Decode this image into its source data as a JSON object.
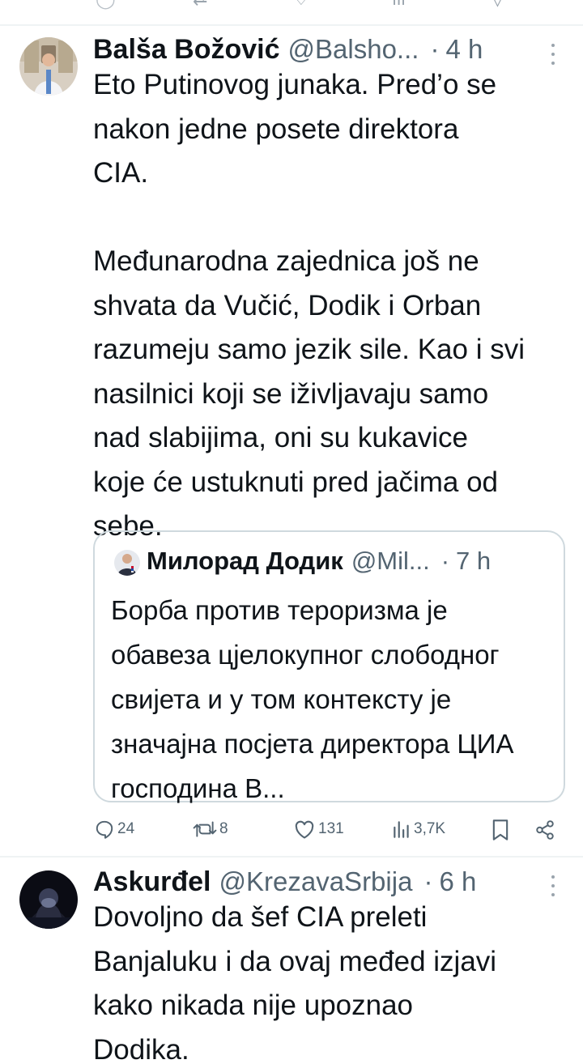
{
  "top_bar": {
    "icons": [
      "reply-icon",
      "retweet-icon",
      "like-icon",
      "views-icon",
      "bookmark-icon"
    ]
  },
  "tweet1": {
    "author_name": "Balša Božović",
    "handle": "@Balsho...",
    "separator": "·",
    "time": "4 h",
    "text": "Eto Putinovog junaka. Pred’o se\nnakon jedne posete direktora\nCIA.\n\nMeđunarodna zajednica još ne\nshvata da Vučić, Dodik i Orban\nrazumeju samo jezik sile. Kao i svi\nnasilnici koji se iživljavaju samo\nnad slabijima, oni su kukavice\nkoje će ustuknuti pred jačima od\nsebe.",
    "quoted": {
      "author_name": "Милорад Додик",
      "handle": "@Mil...",
      "separator": "·",
      "time": "7 h",
      "text": "Борба против тероризма је обавеза цјелокупног слободног свијета и у том контексту је значајна посјета директора ЦИА господина В..."
    },
    "stats": {
      "replies": "24",
      "retweets": "8",
      "likes": "131",
      "views": "3,7K"
    }
  },
  "tweet2": {
    "author_name": "Askurđel",
    "handle": "@KrezavaSrbija",
    "separator": "·",
    "time": "6 h",
    "text": "Dovoljno da šef CIA preleti\nBanjaluku i da ovaj međed izjavi\nkako nikada nije upoznao\nDodika."
  },
  "colors": {
    "text": "#0f1419",
    "secondary": "#536471",
    "border": "#cfd9de",
    "divider": "#eff3f4"
  }
}
